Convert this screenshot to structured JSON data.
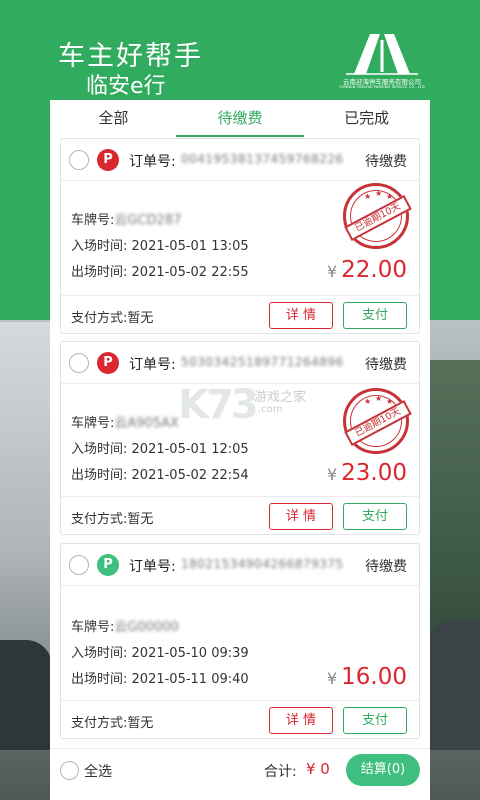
{
  "header": {
    "title": "车主好帮手",
    "subtitle": "临安e行",
    "logo_text": "云南迎海停车服务有限公司",
    "logo_text_en": "YUNNAN YINGHAI PARKING SERVICE CO., LTD"
  },
  "tabs": [
    {
      "label": "全部",
      "active": false
    },
    {
      "label": "待缴费",
      "active": true
    },
    {
      "label": "已完成",
      "active": false
    }
  ],
  "orders": [
    {
      "badge": "P",
      "badge_color": "#d9262f",
      "order_no_label": "订单号:",
      "order_no": "00419538137459768226",
      "status": "待缴费",
      "plate_label": "车牌号:",
      "plate": "云GCD287",
      "entry_label": "入场时间:",
      "entry_time": "2021-05-01 13:05",
      "exit_label": "出场时间:",
      "exit_time": "2021-05-02 22:55",
      "currency": "¥",
      "amount": "22.00",
      "stamp": "已逾期10天",
      "pay_method_label": "支付方式:",
      "pay_method": "暂无",
      "detail_btn": "详 情",
      "pay_btn": "支付"
    },
    {
      "badge": "P",
      "badge_color": "#d9262f",
      "order_no_label": "订单号:",
      "order_no": "50303425189771264896",
      "status": "待缴费",
      "plate_label": "车牌号:",
      "plate": "云A905AX",
      "entry_label": "入场时间:",
      "entry_time": "2021-05-01 12:05",
      "exit_label": "出场时间:",
      "exit_time": "2021-05-02 22:54",
      "currency": "¥",
      "amount": "23.00",
      "stamp": "已逾期10天",
      "pay_method_label": "支付方式:",
      "pay_method": "暂无",
      "detail_btn": "详 情",
      "pay_btn": "支付"
    },
    {
      "badge": "P",
      "badge_color": "#3fbf7f",
      "order_no_label": "订单号:",
      "order_no": "18021534904266879375",
      "status": "待缴费",
      "plate_label": "车牌号:",
      "plate": "云G00000",
      "entry_label": "入场时间:",
      "entry_time": "2021-05-10 09:39",
      "exit_label": "出场时间:",
      "exit_time": "2021-05-11 09:40",
      "currency": "¥",
      "amount": "16.00",
      "pay_method_label": "支付方式:",
      "pay_method": "暂无",
      "detail_btn": "详 情",
      "pay_btn": "支付"
    }
  ],
  "footer": {
    "select_all": "全选",
    "total_label": "合计:",
    "total_value": "¥ 0",
    "checkout": "结算(0)"
  },
  "watermark": {
    "brand": "K73",
    "cn": "游戏之家",
    "com": ".com"
  },
  "colors": {
    "brand_green": "#31ac5f",
    "accent_red": "#d9262f"
  }
}
